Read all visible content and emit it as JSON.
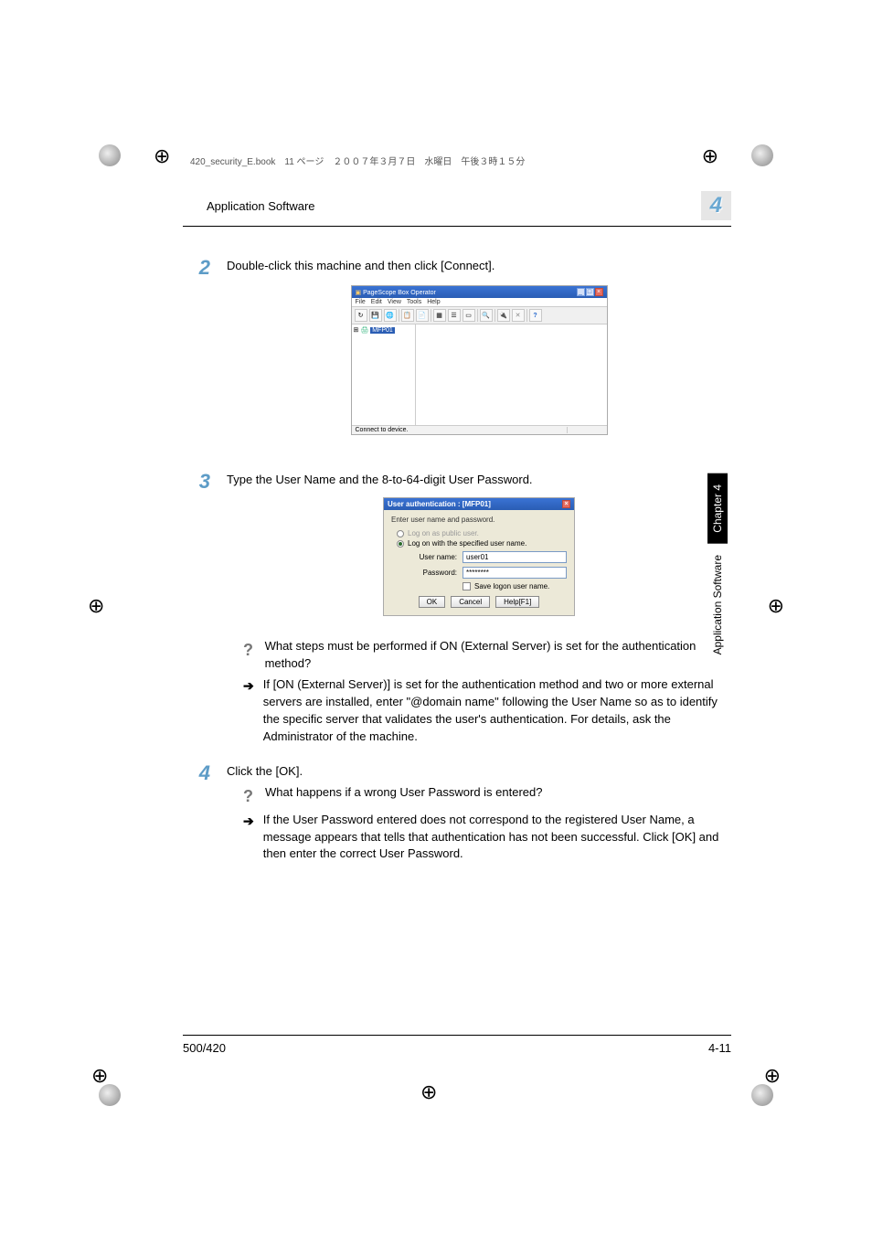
{
  "print_header": "420_security_E.book　11 ページ　２００７年３月７日　水曜日　午後３時１５分",
  "section_title": "Application Software",
  "chapter_number": "4",
  "side_chapter": "Chapter 4",
  "side_label": "Application Software",
  "footer_left": "500/420",
  "footer_right": "4-11",
  "steps": {
    "2": {
      "text": "Double-click this machine and then click [Connect]."
    },
    "3": {
      "text": "Type the User Name and the 8-to-64-digit User Password.",
      "question": "What steps must be performed if ON (External Server) is set for the authentication method?",
      "answer": "If [ON (External Server)] is set for the authentication method and two or more external servers are installed, enter \"@domain name\" following the User Name so as to identify the specific server that validates the user's authentication. For details, ask the Administrator of the machine."
    },
    "4": {
      "text": "Click the [OK].",
      "question": "What happens if a wrong User Password is entered?",
      "answer": "If the User Password entered does not correspond to the registered User Name, a message appears that tells that authentication has not been successful. Click [OK] and then enter the correct User Password."
    }
  },
  "screenshot1": {
    "title": "PageScope Box Operator",
    "menu": [
      "File",
      "Edit",
      "View",
      "Tools",
      "Help"
    ],
    "tree_item": "MFP01",
    "status": "Connect to device."
  },
  "screenshot2": {
    "title": "User authentication : [MFP01]",
    "instruction": "Enter user name and password.",
    "radio_public": "Log on as public user.",
    "radio_user": "Log on with the specified user name.",
    "label_user": "User name:",
    "value_user": "user01",
    "label_pass": "Password:",
    "value_pass": "********",
    "save_check": "Save logon user name.",
    "btn_ok": "OK",
    "btn_cancel": "Cancel",
    "btn_help": "Help[F1]"
  }
}
